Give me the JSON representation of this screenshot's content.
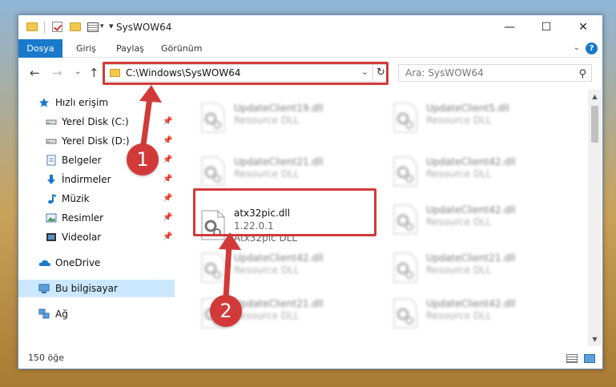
{
  "window": {
    "title": "SysWOW64",
    "minimize": "—",
    "maximize": "☐",
    "close": "✕"
  },
  "ribbon": {
    "tabs": [
      "Dosya",
      "Giriş",
      "Paylaş",
      "Görünüm"
    ],
    "help": "?"
  },
  "nav": {
    "address": "C:\\Windows\\SysWOW64",
    "search_placeholder": "Ara: SysWOW64"
  },
  "sidebar": {
    "quick_access": "Hızlı erişim",
    "items": [
      {
        "label": "Yerel Disk (C:)",
        "icon": "drive-icon",
        "pinned": true
      },
      {
        "label": "Yerel Disk (D:)",
        "icon": "drive-icon",
        "pinned": true
      },
      {
        "label": "Belgeler",
        "icon": "documents-icon",
        "pinned": true
      },
      {
        "label": "İndirmeler",
        "icon": "downloads-icon",
        "pinned": true
      },
      {
        "label": "Müzik",
        "icon": "music-icon",
        "pinned": true
      },
      {
        "label": "Resimler",
        "icon": "pictures-icon",
        "pinned": true
      },
      {
        "label": "Videolar",
        "icon": "videos-icon",
        "pinned": true
      }
    ],
    "onedrive": "OneDrive",
    "this_pc": "Bu bilgisayar",
    "network": "Ağ"
  },
  "files": {
    "left": [
      {
        "name": "UpdateClient19.dll",
        "desc": "Resource DLL"
      },
      {
        "name": "UpdateClient21.dll",
        "desc": "Resource DLL"
      },
      {
        "name": "atx32pic.dll",
        "version": "1.22.0.1",
        "desc": "Atx32pic DLL"
      },
      {
        "name": "UpdateClient42.dll",
        "desc": "Resource DLL"
      },
      {
        "name": "UpdateClient21.dll",
        "desc": "Resource DLL"
      }
    ],
    "right": [
      {
        "name": "UpdateClient5.dll",
        "desc": "Resource DLL"
      },
      {
        "name": "UpdateClient42.dll",
        "desc": "Resource DLL"
      },
      {
        "name": "UpdateClient42.dll",
        "desc": "Resource DLL"
      },
      {
        "name": "UpdateClient21.dll",
        "desc": "Resource DLL"
      },
      {
        "name": "UpdateClient42.dll",
        "desc": "Resource DLL"
      }
    ]
  },
  "status": {
    "count": "150 öğe"
  },
  "callouts": [
    "1",
    "2"
  ],
  "colors": {
    "accent": "#1979ca",
    "highlight": "#d23a3a",
    "selected": "#cce8ff"
  }
}
